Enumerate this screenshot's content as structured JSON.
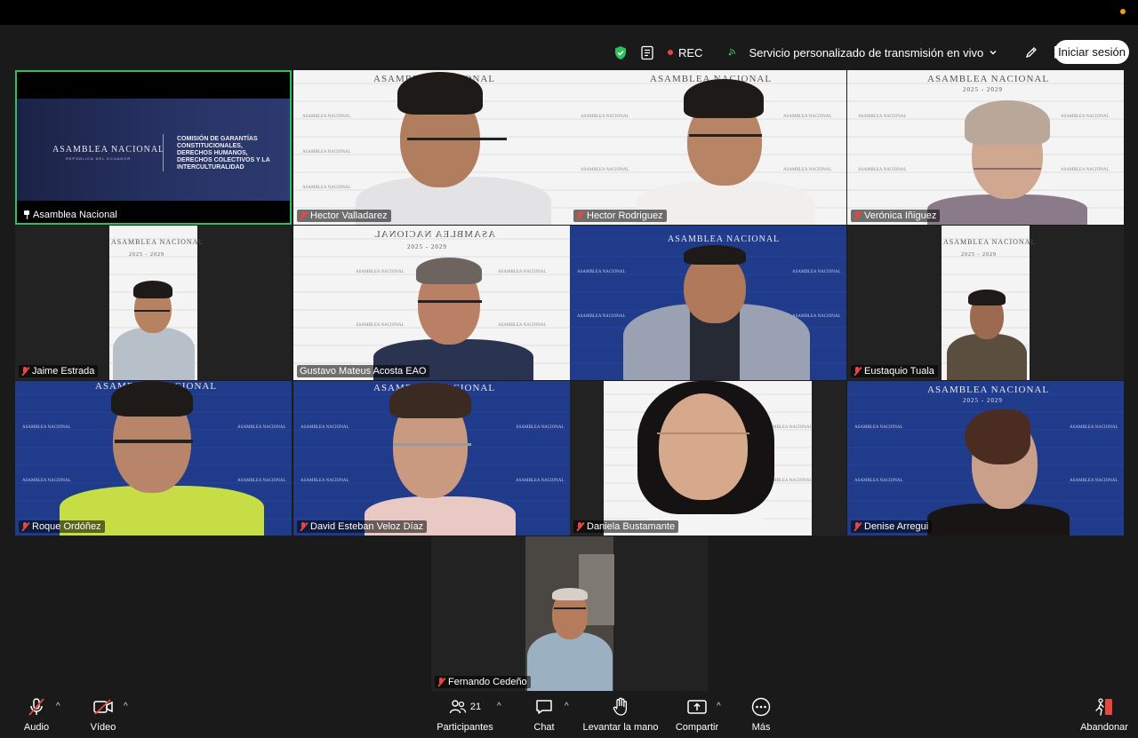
{
  "topbar": {
    "rec_label": "REC",
    "stream_label": "Servicio personalizado de transmisión en vivo",
    "signin_label": "Iniciar sesión"
  },
  "presentation": {
    "name": "ASAMBLEA NACIONAL",
    "subtitle": "REPÚBLICA DEL ECUADOR",
    "title": "COMISIÓN DE GARANTÍAS CONSTITUCIONALES, DERECHOS HUMANOS, DERECHOS COLECTIVOS Y LA INTERCULTURALIDAD"
  },
  "backdrop": {
    "brand": "ASAMBLEA NACIONAL",
    "years": "2025 - 2029",
    "pattern_text": "ASAMBLEA NACIONAL"
  },
  "participants": [
    {
      "name": "Asamblea Nacional",
      "pinned": true
    },
    {
      "name": "Hector Valladarez"
    },
    {
      "name": "Hector Rodriguez"
    },
    {
      "name": "Verónica Iñiguez"
    },
    {
      "name": "Jaime Estrada"
    },
    {
      "name": "Gustavo Mateus Acosta EAO"
    },
    {
      "name": "Eustaquio Tuala"
    },
    {
      "name": "Roque Ordóñez"
    },
    {
      "name": "David Esteban Veloz Díaz"
    },
    {
      "name": "Daniela Bustamante"
    },
    {
      "name": "Denise Arregui"
    },
    {
      "name": "Fernando Cedeño"
    }
  ],
  "controls": {
    "audio": "Audio",
    "video": "Vídeo",
    "participants": "Participantes",
    "participants_count": "21",
    "chat": "Chat",
    "raise_hand": "Levantar la mano",
    "share": "Compartir",
    "more": "Más",
    "leave": "Abandonar"
  }
}
